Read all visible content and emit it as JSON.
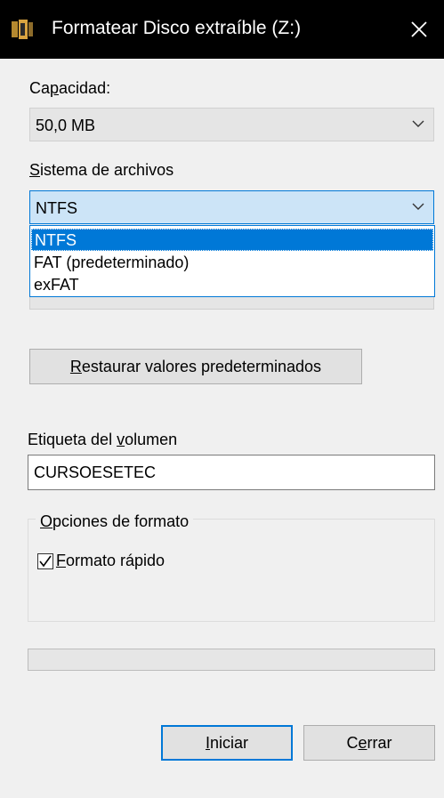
{
  "window": {
    "title": "Formatear Disco extraíble (Z:)",
    "icon": "drive-format-icon",
    "close_icon": "close-icon"
  },
  "capacity": {
    "label": "Capacidad:",
    "access_key": "p",
    "value": "50,0 MB"
  },
  "filesystem": {
    "label": "Sistema de archivos",
    "access_key": "S",
    "value": "NTFS",
    "options": [
      "NTFS",
      "FAT (predeterminado)",
      "exFAT"
    ],
    "selected_index": 0
  },
  "restore_button": {
    "label": "Restaurar valores predeterminados",
    "access_key": "R"
  },
  "volume_label": {
    "label": "Etiqueta del volumen",
    "access_key": "v",
    "value": "CURSOESETEC"
  },
  "format_options": {
    "group_title": "Opciones de formato",
    "access_key": "O",
    "quick_format_label": "Formato rápido",
    "quick_format_checked": true
  },
  "progress": {
    "value": 0
  },
  "buttons": {
    "start": "Iniciar",
    "close": "Cerrar"
  },
  "colors": {
    "accent": "#0078d7",
    "titlebar": "#000000",
    "background": "#f0f0f0"
  }
}
